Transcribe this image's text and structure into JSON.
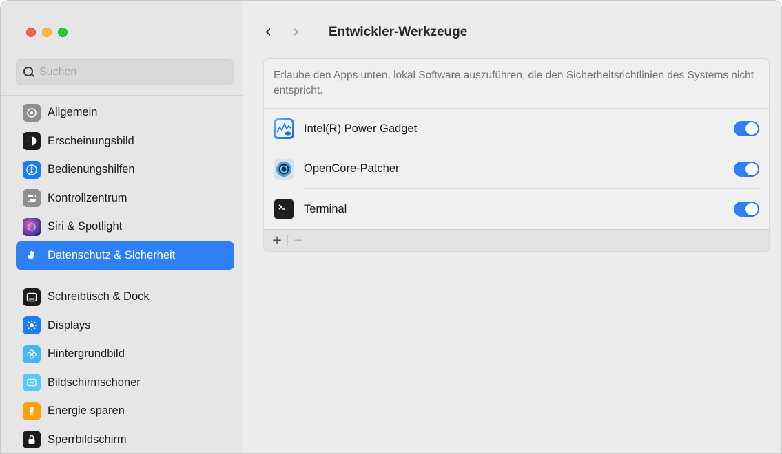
{
  "window": {
    "traffic_lights": {
      "close": "#fe5f57",
      "minimize": "#febc2e",
      "maximize": "#28c840"
    }
  },
  "sidebar": {
    "search_placeholder": "Suchen",
    "items": [
      {
        "label": "Allgemein",
        "icon": "gear-icon",
        "color": "#8e8e93"
      },
      {
        "label": "Erscheinungsbild",
        "icon": "appearance-icon",
        "color": "#1c1c1e"
      },
      {
        "label": "Bedienungshilfen",
        "icon": "accessibility-icon",
        "color": "#1f7bf5"
      },
      {
        "label": "Kontrollzentrum",
        "icon": "control-center-icon",
        "color": "#8e8e93"
      },
      {
        "label": "Siri & Spotlight",
        "icon": "siri-icon",
        "color": "#5e3fb5"
      },
      {
        "label": "Datenschutz & Sicherheit",
        "icon": "hand-icon",
        "color": "#2f80f5",
        "active": true
      },
      {
        "label": "Schreibtisch & Dock",
        "icon": "dock-icon",
        "color": "#1c1c1e"
      },
      {
        "label": "Displays",
        "icon": "sun-icon",
        "color": "#1f7bf5"
      },
      {
        "label": "Hintergrundbild",
        "icon": "flower-icon",
        "color": "#44b6f2"
      },
      {
        "label": "Bildschirmschoner",
        "icon": "screensaver-icon",
        "color": "#5ac8fa"
      },
      {
        "label": "Energie sparen",
        "icon": "battery-icon",
        "color": "#ff9f0a"
      },
      {
        "label": "Sperrbildschirm",
        "icon": "lock-icon",
        "color": "#1c1c1e"
      }
    ]
  },
  "main": {
    "back_label": "‹",
    "forward_label": "›",
    "title": "Entwickler-Werkzeuge",
    "description": "Erlaube den Apps unten, lokal Software auszuführen, die den Sicherheitsrichtlinien des Systems nicht entspricht.",
    "apps": [
      {
        "name": "Intel(R) Power Gadget",
        "icon": "power-gadget-icon",
        "enabled": true
      },
      {
        "name": "OpenCore-Patcher",
        "icon": "opencore-icon",
        "enabled": true
      },
      {
        "name": "Terminal",
        "icon": "terminal-icon",
        "enabled": true
      }
    ],
    "add_label": "+",
    "remove_label": "−",
    "accent": "#2f80f5"
  }
}
